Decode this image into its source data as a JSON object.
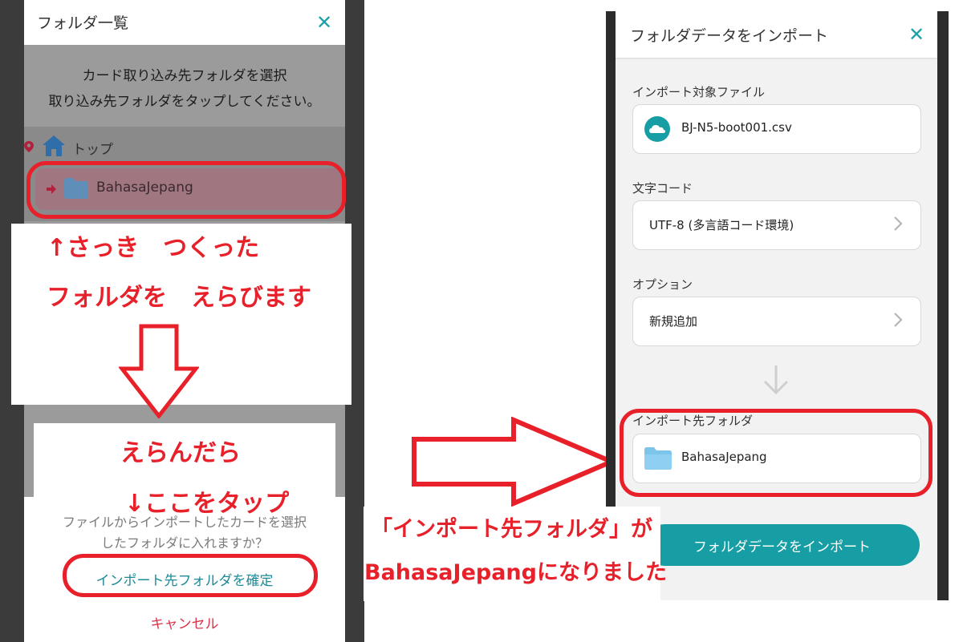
{
  "left_panel": {
    "title": "フォルダ一覧",
    "close_icon": "close-icon",
    "instruction_title": "カード取り込み先フォルダを選択",
    "instruction_body": "取り込み先フォルダをタップしてください。",
    "tree": {
      "root_label": "トップ",
      "selected_folder": "BahasaJepang"
    },
    "dialog": {
      "message_line1": "ファイルからインポートしたカードを選択",
      "message_line2": "したフォルダに入れますか？",
      "confirm_label": "インポート先フォルダを確定",
      "cancel_label": "キャンセル"
    }
  },
  "right_panel": {
    "title": "フォルダデータをインポート",
    "file_label": "インポート対象ファイル",
    "file_name": "BJ-N5-boot001.csv",
    "encoding_label": "文字コード",
    "encoding_value": "UTF-8 (多言語コード環境)",
    "option_label": "オプション",
    "option_value": "新規追加",
    "dest_label": "インポート先フォルダ",
    "dest_folder": "BahasaJepang",
    "import_button": "フォルダデータをインポート"
  },
  "annotations": {
    "line1": "↑さっき　つくった",
    "line2": "フォルダを　えらびます",
    "line3": "えらんだら",
    "line4": "↓ここをタップ",
    "line5": "「インポート先フォルダ」が",
    "line6": "BahasaJepangになりました"
  },
  "colors": {
    "accent": "#169ea4",
    "annotation_red": "#e8202a",
    "cancel_red": "#d9334a"
  }
}
